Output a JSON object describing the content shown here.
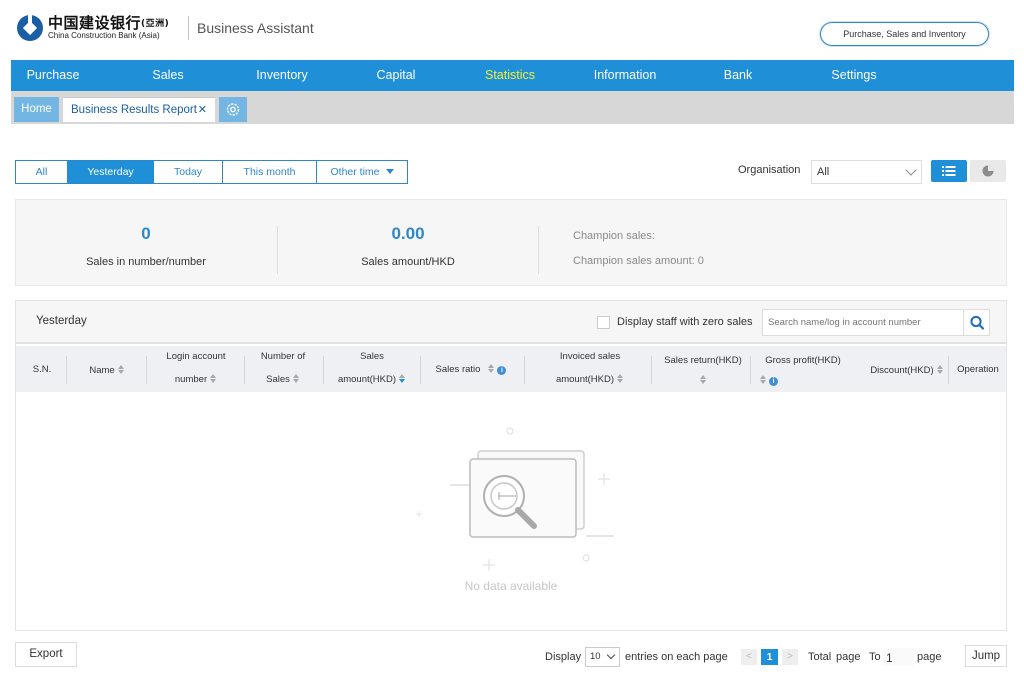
{
  "brand": {
    "name_cn": "中国建设银行",
    "name_cn_suffix": "(亞洲)",
    "name_en": "China Construction Bank (Asia)",
    "app_title": "Business Assistant",
    "logo_color": "#1a5fa3"
  },
  "module_switch": {
    "label": "Purchase, Sales and Inventory"
  },
  "nav": {
    "items": [
      {
        "label": "Purchase"
      },
      {
        "label": "Sales"
      },
      {
        "label": "Inventory"
      },
      {
        "label": "Capital"
      },
      {
        "label": "Statistics",
        "active": true
      },
      {
        "label": "Information"
      },
      {
        "label": "Bank"
      },
      {
        "label": "Settings"
      }
    ],
    "bg_color": "#1f8fd8",
    "active_color": "#f2ef3a"
  },
  "tabs": {
    "home": "Home",
    "current": "Business Results Report",
    "close_glyph": "✕",
    "settings_icon": "gear-icon"
  },
  "filter": {
    "periods": [
      "All",
      "Yesterday",
      "Today",
      "This month",
      "Other time"
    ],
    "selected_period": "Yesterday",
    "org_label": "Organisation",
    "org_value": "All",
    "views": [
      "list-icon",
      "pie-icon"
    ],
    "selected_view": "list-icon"
  },
  "summary": {
    "sales_count": "0",
    "sales_count_label": "Sales in number/number",
    "sales_amount": "0.00",
    "sales_amount_label": "Sales amount/HKD",
    "champion_sales": "Champion sales:",
    "champion_amount": "Champion sales amount: 0"
  },
  "table": {
    "title": "Yesterday",
    "zero_sales_label": "Display staff with zero sales",
    "search_placeholder": "Search name/log in account number",
    "columns": {
      "sn": "S.N.",
      "name": "Name",
      "login_1": "Login account",
      "login_2": "number",
      "num_1": "Number of",
      "num_2": "Sales",
      "amount_1": "Sales",
      "amount_2": "amount(HKD)",
      "ratio": "Sales ratio",
      "invoiced_1": "Invoiced sales",
      "invoiced_2": "amount(HKD)",
      "return": "Sales return(HKD)",
      "gross": "Gross profit(HKD)",
      "discount": "Discount(HKD)",
      "operation": "Operation"
    },
    "sorted_column": "amount(HKD)",
    "empty_text": "No data available"
  },
  "footer": {
    "export": "Export",
    "display": "Display",
    "page_size": "10",
    "entries_label": "entries on each page",
    "prev": "<",
    "current_page": "1",
    "next": ">",
    "total": "Total",
    "page_word": "page",
    "to": "To",
    "goto_value": "1",
    "page_suffix": "page",
    "jump": "Jump"
  }
}
